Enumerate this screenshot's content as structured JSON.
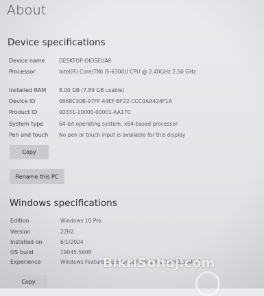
{
  "page": {
    "title": "About"
  },
  "device_specifications": {
    "heading": "Device specifications",
    "rows": [
      {
        "label": "Device name",
        "value": "DESKTOP-OIOSEUA8"
      },
      {
        "label": "Processor",
        "value": "Intel(R) Core(TM) i5-6300U CPU @ 2.40GHz   2.50 GHz"
      },
      {
        "label": "Installed RAM",
        "value": "8.00 GB (7.89 GB usable)"
      },
      {
        "label": "Device ID",
        "value": "0868C30B-97FF-44EF-BF22-CCC0AA424F1A"
      },
      {
        "label": "Product ID",
        "value": "00331-10000-00001-AA170"
      },
      {
        "label": "System type",
        "value": "64-bit operating system, x64-based processor"
      },
      {
        "label": "Pen and touch",
        "value": "No pen or touch input is available for this display"
      }
    ],
    "copy_button": "Copy",
    "rename_button": "Rename this PC"
  },
  "windows_specifications": {
    "heading": "Windows specifications",
    "rows": [
      {
        "label": "Edition",
        "value": "Windows 10 Pro"
      },
      {
        "label": "Version",
        "value": "22H2"
      },
      {
        "label": "Installed on",
        "value": "6/1/2024"
      },
      {
        "label": "OS build",
        "value": "19045.5608"
      },
      {
        "label": "Experience",
        "value": "Windows Feature Experience Pack 1000.19061.1000.0"
      }
    ],
    "copy_button": "Copy"
  },
  "watermark": {
    "text": "BikriSohoj.com"
  }
}
